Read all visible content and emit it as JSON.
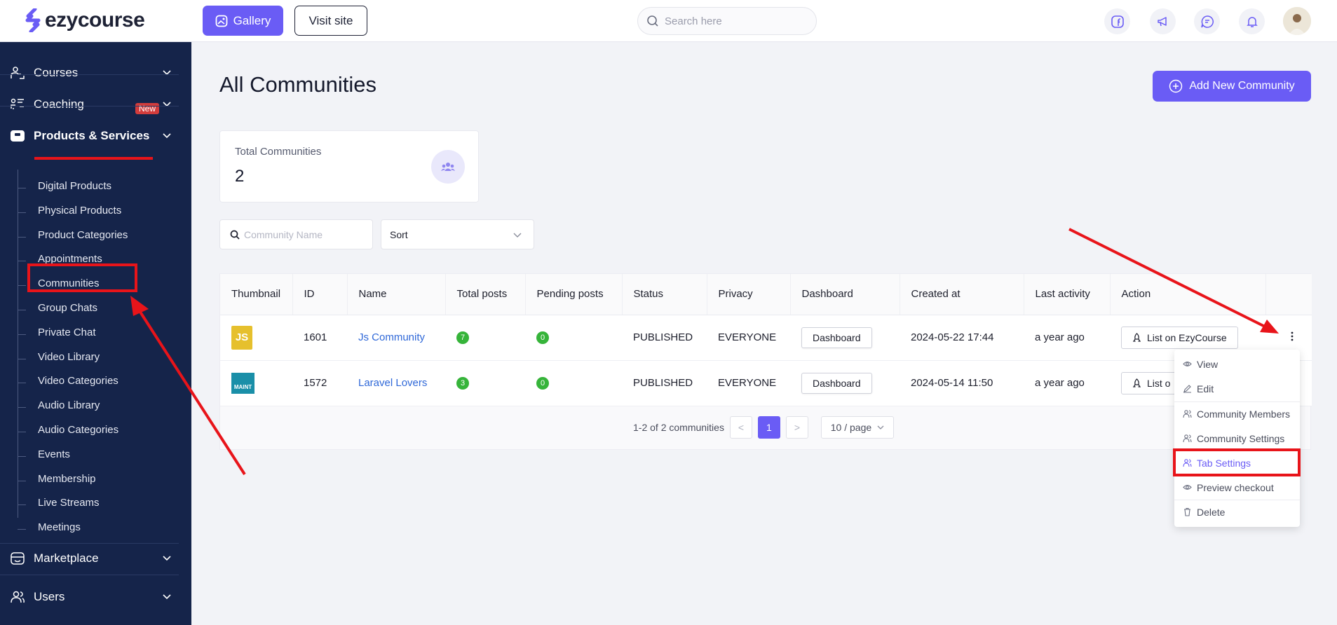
{
  "brand": {
    "name": "ezycourse"
  },
  "topbar": {
    "gallery_label": "Gallery",
    "visit_label": "Visit site",
    "search_placeholder": "Search here"
  },
  "sidebar": {
    "main_items": [
      {
        "label": "Courses"
      },
      {
        "label": "Coaching",
        "badge": "New"
      },
      {
        "label": "Products & Services"
      },
      {
        "label": "Marketplace"
      },
      {
        "label": "Users"
      }
    ],
    "sub_items": [
      "Digital Products",
      "Physical Products",
      "Product Categories",
      "Appointments",
      "Communities",
      "Group Chats",
      "Private Chat",
      "Video Library",
      "Video Categories",
      "Audio Library",
      "Audio Categories",
      "Events",
      "Membership",
      "Live Streams",
      "Meetings"
    ]
  },
  "page": {
    "title": "All Communities",
    "add_button": "Add New Community",
    "stat": {
      "label": "Total Communities",
      "value": "2"
    },
    "filter_placeholder": "Community Name",
    "sort_label": "Sort"
  },
  "table": {
    "headers": [
      "Thumbnail",
      "ID",
      "Name",
      "Total posts",
      "Pending posts",
      "Status",
      "Privacy",
      "Dashboard",
      "Created at",
      "Last activity",
      "Action"
    ],
    "rows": [
      {
        "thumb": "JS",
        "id": "1601",
        "name": "Js Community",
        "total_posts": "7",
        "pending_posts": "0",
        "status": "PUBLISHED",
        "privacy": "EVERYONE",
        "dashboard": "Dashboard",
        "created_at": "2024-05-22 17:44",
        "last_activity": "a year ago",
        "action": "List on EzyCourse"
      },
      {
        "thumb": "MAINT",
        "id": "1572",
        "name": "Laravel Lovers",
        "total_posts": "3",
        "pending_posts": "0",
        "status": "PUBLISHED",
        "privacy": "EVERYONE",
        "dashboard": "Dashboard",
        "created_at": "2024-05-14 11:50",
        "last_activity": "a year ago",
        "action": "List o"
      }
    ]
  },
  "pagination": {
    "summary": "1-2 of 2 communities",
    "current": "1",
    "page_size": "10 / page",
    "prev": "<",
    "next": ">"
  },
  "menu": {
    "items": [
      "View",
      "Edit",
      "Community Members",
      "Community Settings",
      "Tab Settings",
      "Preview checkout",
      "Delete"
    ],
    "active_index": 4
  },
  "colors": {
    "accent": "#6a5cf5",
    "sidebar": "#15244a",
    "annotation": "#e8141a",
    "link": "#2f68d8",
    "count_badge": "#36b43a"
  }
}
